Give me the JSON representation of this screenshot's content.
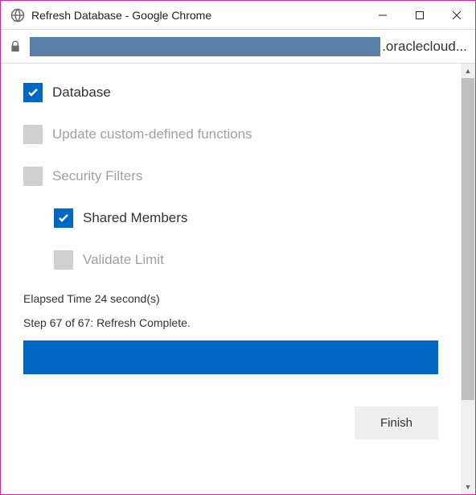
{
  "window": {
    "title": "Refresh Database - Google Chrome"
  },
  "address": {
    "url_suffix": ".oraclecloud..."
  },
  "options": {
    "database": {
      "label": "Database",
      "checked": true,
      "enabled": true
    },
    "update_funcs": {
      "label": "Update custom-defined functions",
      "checked": false,
      "enabled": false
    },
    "security_filters": {
      "label": "Security Filters",
      "checked": false,
      "enabled": false
    },
    "shared_members": {
      "label": "Shared Members",
      "checked": true,
      "enabled": true
    },
    "validate_limit": {
      "label": "Validate Limit",
      "checked": false,
      "enabled": false
    }
  },
  "status": {
    "elapsed": "Elapsed Time 24 second(s)",
    "step": "Step 67 of 67: Refresh Complete."
  },
  "buttons": {
    "finish": "Finish"
  },
  "colors": {
    "accent": "#0067c5"
  }
}
